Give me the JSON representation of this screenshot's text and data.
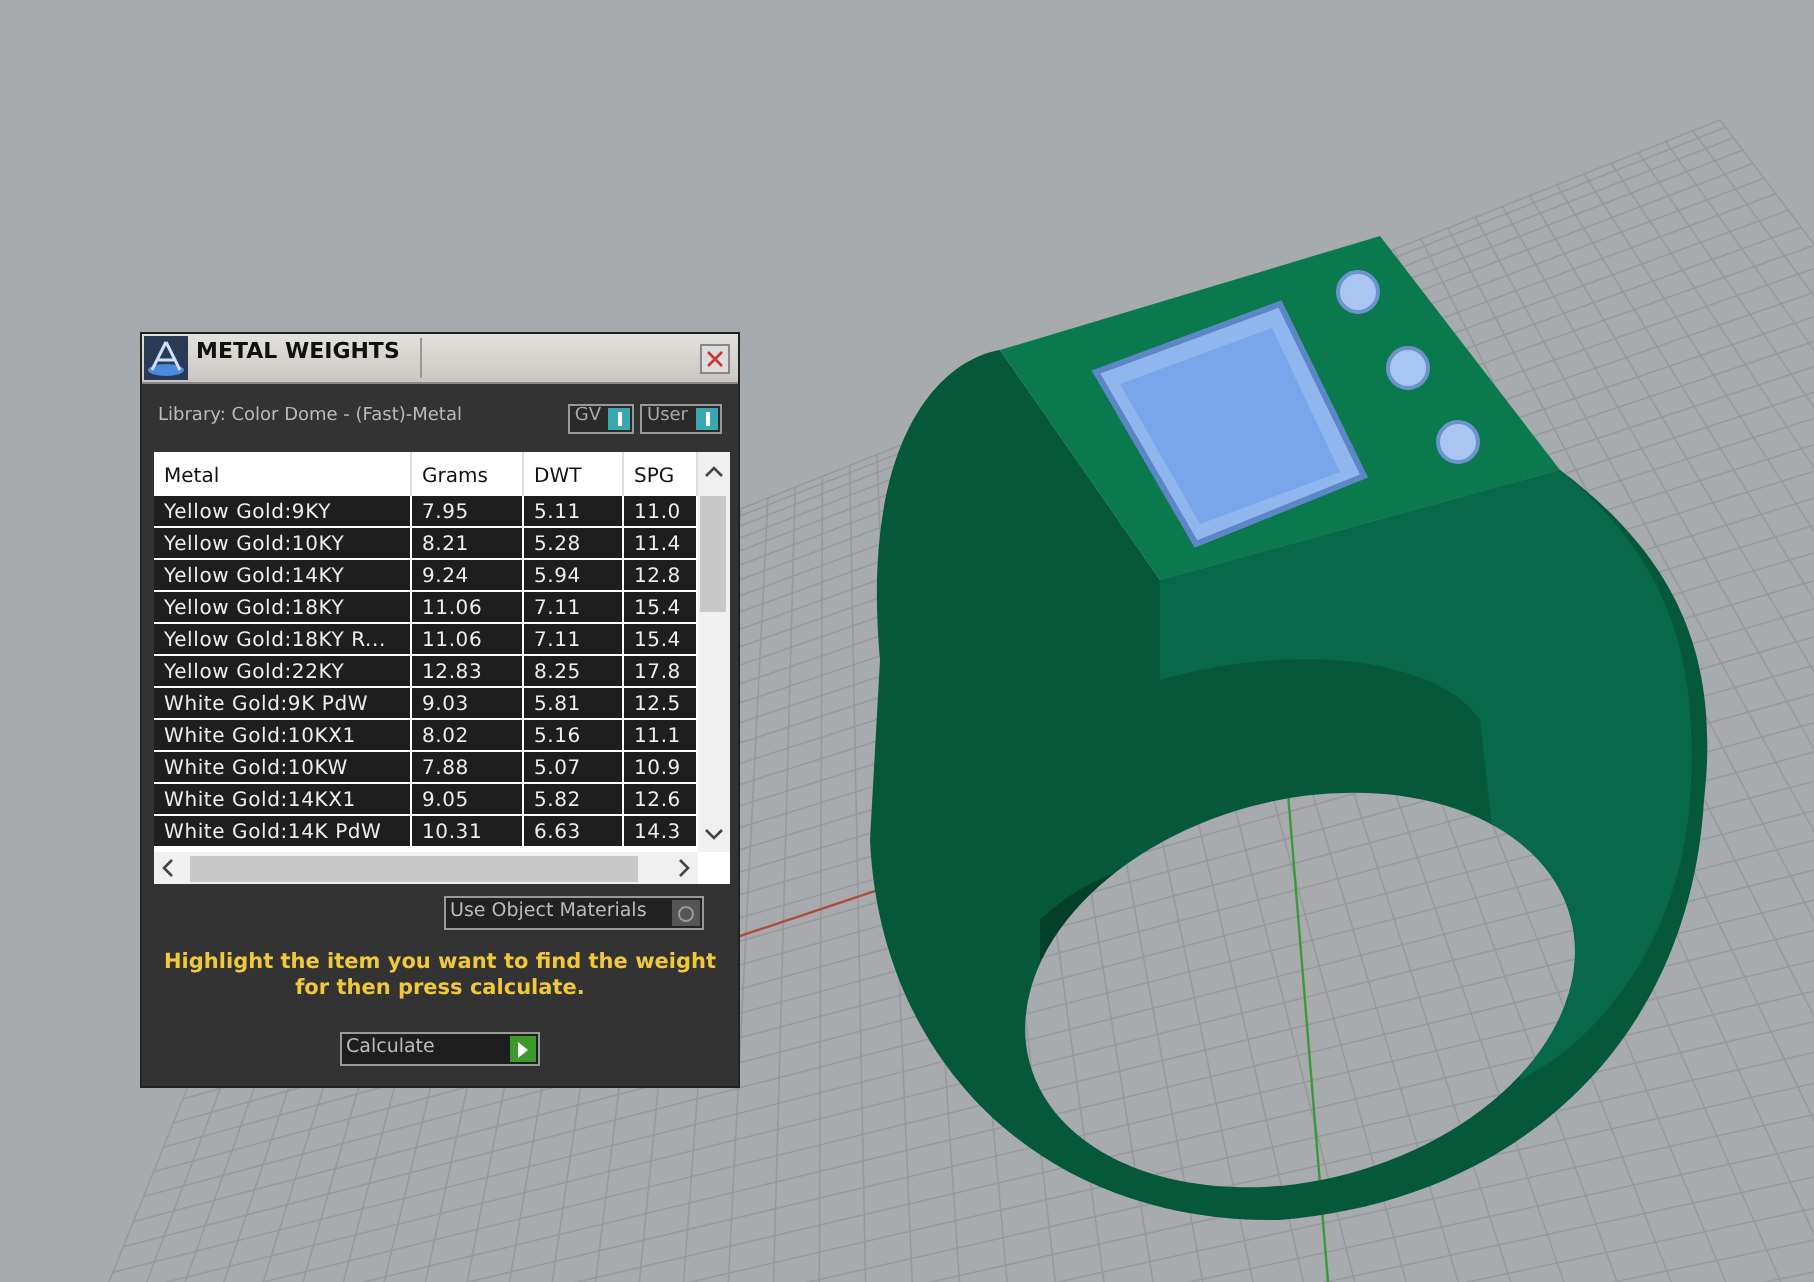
{
  "panel": {
    "title": "METAL WEIGHTS",
    "library_label": "Library: Color Dome - (Fast)-Metal",
    "toggles": [
      {
        "label": "GV",
        "on": true
      },
      {
        "label": "User",
        "on": true
      }
    ],
    "table": {
      "columns": [
        "Metal",
        "Grams",
        "DWT",
        "SPG"
      ],
      "rows": [
        {
          "cells": [
            "Yellow Gold:9KY",
            "7.95",
            "5.11",
            "11.0"
          ]
        },
        {
          "cells": [
            "Yellow Gold:10KY",
            "8.21",
            "5.28",
            "11.4"
          ]
        },
        {
          "cells": [
            "Yellow Gold:14KY",
            "9.24",
            "5.94",
            "12.8"
          ]
        },
        {
          "cells": [
            "Yellow Gold:18KY",
            "11.06",
            "7.11",
            "15.4"
          ]
        },
        {
          "cells": [
            "Yellow Gold:18KY R...",
            "11.06",
            "7.11",
            "15.4"
          ]
        },
        {
          "cells": [
            "Yellow Gold:22KY",
            "12.83",
            "8.25",
            "17.8"
          ]
        },
        {
          "cells": [
            "White Gold:9K PdW",
            "9.03",
            "5.81",
            "12.5"
          ]
        },
        {
          "cells": [
            "White Gold:10KX1",
            "8.02",
            "5.16",
            "11.1"
          ]
        },
        {
          "cells": [
            "White Gold:10KW",
            "7.88",
            "5.07",
            "10.9"
          ]
        },
        {
          "cells": [
            "White Gold:14KX1",
            "9.05",
            "5.82",
            "12.6"
          ]
        },
        {
          "cells": [
            "White Gold:14K PdW",
            "10.31",
            "6.63",
            "14.3"
          ]
        }
      ]
    },
    "use_object_materials": {
      "label": "Use Object Materials",
      "checked": false
    },
    "instruction": "Highlight the item you want to find the weight for then press calculate.",
    "calculate_button": "Calculate"
  }
}
